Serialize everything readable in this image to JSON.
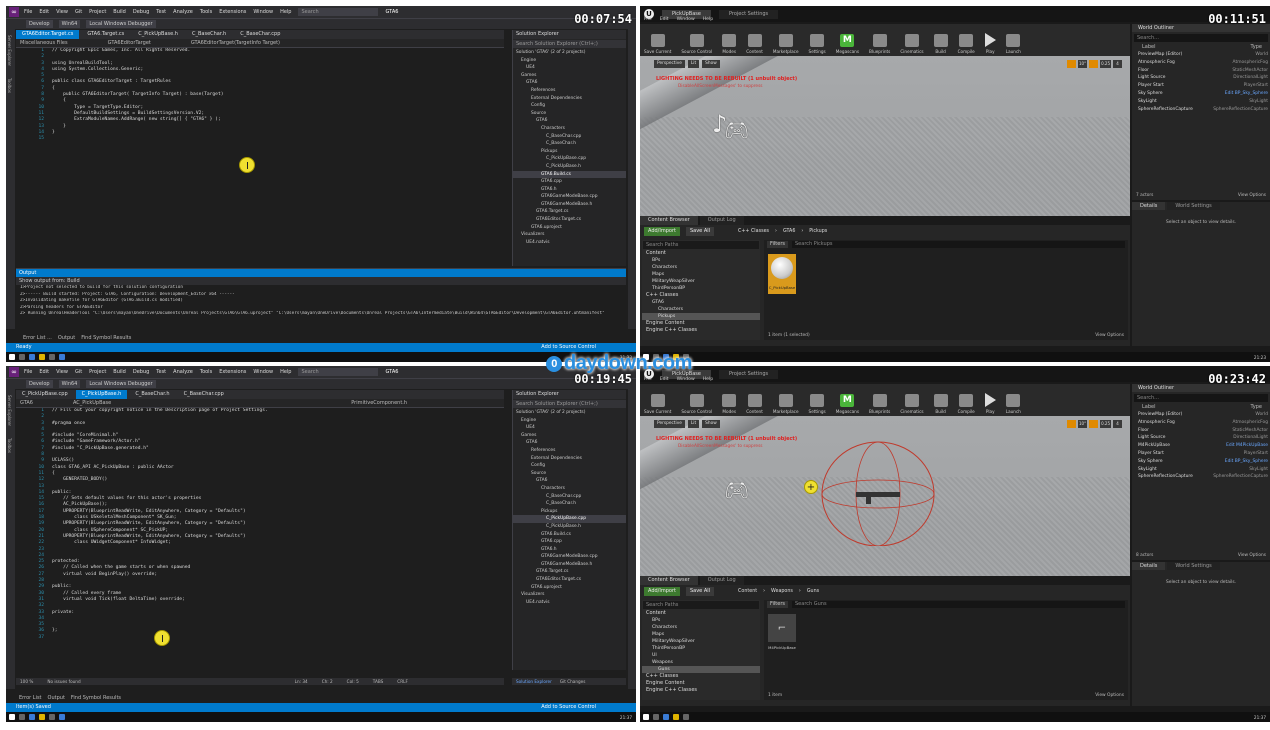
{
  "watermark": "daydown.com",
  "watermark_badge": "0",
  "q1": {
    "timer": "00:07:54",
    "menus": [
      "File",
      "Edit",
      "View",
      "Git",
      "Project",
      "Build",
      "Debug",
      "Test",
      "Analyze",
      "Tools",
      "Extensions",
      "Window",
      "Help"
    ],
    "search": "Search",
    "title": "GTA6",
    "debugger": "Local Windows Debugger",
    "config": "Develop",
    "platform": "Win64",
    "left_strip": [
      "Server Explorer",
      "Toolbox"
    ],
    "tabs": [
      {
        "label": "GTA6Editor.Target.cs",
        "active": true
      },
      {
        "label": "GTA6.Target.cs",
        "active": false
      },
      {
        "label": "C_PickUpBase.h",
        "active": false
      },
      {
        "label": "C_BaseChar.h",
        "active": false
      },
      {
        "label": "C_BaseChar.cpp",
        "active": false
      }
    ],
    "nav": [
      "Miscellaneous Files",
      "GTA6EditorTarget",
      "GTA6EditorTarget(TargetInfo Target)"
    ],
    "code": [
      {
        "n": "1",
        "t": "// Copyright Epic Games, Inc. All Rights Reserved."
      },
      {
        "n": "2",
        "t": ""
      },
      {
        "n": "3",
        "t": "using UnrealBuildTool;"
      },
      {
        "n": "4",
        "t": "using System.Collections.Generic;"
      },
      {
        "n": "5",
        "t": ""
      },
      {
        "n": "6",
        "t": "public class GTA6EditorTarget : TargetRules"
      },
      {
        "n": "7",
        "t": "{"
      },
      {
        "n": "8",
        "t": "    public GTA6EditorTarget( TargetInfo Target) : base(Target)"
      },
      {
        "n": "9",
        "t": "    {"
      },
      {
        "n": "10",
        "t": "        Type = TargetType.Editor;"
      },
      {
        "n": "11",
        "t": "        DefaultBuildSettings = BuildSettingsVersion.V2;"
      },
      {
        "n": "12",
        "t": "        ExtraModuleNames.AddRange( new string[] { \"GTA6\" } );"
      },
      {
        "n": "13",
        "t": "    }"
      },
      {
        "n": "14",
        "t": "}"
      },
      {
        "n": "15",
        "t": ""
      }
    ],
    "se_title": "Solution Explorer",
    "se_search": "Search Solution Explorer (Ctrl+;)",
    "se_items": [
      {
        "t": "Solution 'GTA6' (2 of 2 projects)",
        "d": 0,
        "sel": false
      },
      {
        "t": "Engine",
        "d": 1,
        "sel": false
      },
      {
        "t": "UE4",
        "d": 2,
        "sel": false
      },
      {
        "t": "Games",
        "d": 1,
        "sel": false
      },
      {
        "t": "GTA6",
        "d": 2,
        "sel": false
      },
      {
        "t": "References",
        "d": 3,
        "sel": false
      },
      {
        "t": "External Dependencies",
        "d": 3,
        "sel": false
      },
      {
        "t": "Config",
        "d": 3,
        "sel": false
      },
      {
        "t": "Source",
        "d": 3,
        "sel": false
      },
      {
        "t": "GTA6",
        "d": 4,
        "sel": false
      },
      {
        "t": "Characters",
        "d": 5,
        "sel": false
      },
      {
        "t": "C_BaseChar.cpp",
        "d": 6,
        "sel": false
      },
      {
        "t": "C_BaseChar.h",
        "d": 6,
        "sel": false
      },
      {
        "t": "Pickups",
        "d": 5,
        "sel": false
      },
      {
        "t": "C_PickUpBase.cpp",
        "d": 6,
        "sel": false
      },
      {
        "t": "C_PickUpBase.h",
        "d": 6,
        "sel": false
      },
      {
        "t": "GTA6.Build.cs",
        "d": 5,
        "sel": true
      },
      {
        "t": "GTA6.cpp",
        "d": 5,
        "sel": false
      },
      {
        "t": "GTA6.h",
        "d": 5,
        "sel": false
      },
      {
        "t": "GTA6GameModeBase.cpp",
        "d": 5,
        "sel": false
      },
      {
        "t": "GTA6GameModeBase.h",
        "d": 5,
        "sel": false
      },
      {
        "t": "GTA6.Target.cs",
        "d": 4,
        "sel": false
      },
      {
        "t": "GTA6Editor.Target.cs",
        "d": 4,
        "sel": false
      },
      {
        "t": "GTA6.uproject",
        "d": 3,
        "sel": false
      },
      {
        "t": "Visualizers",
        "d": 1,
        "sel": false
      },
      {
        "t": "UE4.natvis",
        "d": 2,
        "sel": false
      }
    ],
    "output_title": "Output",
    "output_from": "Show output from:  Build",
    "output_lines": [
      "1>Project not selected to build for this solution configuration",
      "2>------ Build started: Project: GTA6, Configuration: Development_Editor x64 ------",
      "2>Invalidating makefile for GTA6Editor (GTA6.Build.cs modified)",
      "2>Parsing headers for GTA6Editor",
      "2>  Running UnrealHeaderTool \"C:\\Users\\mayan\\OneDrive\\Documents\\Unreal Projects\\GTA6\\GTA6.uproject\" \"C:\\Users\\mayan\\OneDrive\\Documents\\Unreal Projects\\GTA6\\Intermediate\\Build\\Win64\\GTA6Editor\\Development\\GTA6Editor.uhtmanifest\""
    ],
    "output_tabs": [
      "Error List ...",
      "Output",
      "Find Symbol Results"
    ],
    "status_left": "Ready",
    "status_right": "Add to Source Control",
    "clock": "21:23"
  },
  "q2": {
    "timer": "00:11:51",
    "tabs": [
      "PickUpBase",
      "Project Settings"
    ],
    "menus": [
      "File",
      "Edit",
      "Window",
      "Help"
    ],
    "tools": [
      "Save Current",
      "Source Control",
      "Modes",
      "Content",
      "Marketplace",
      "Settings",
      "Megascans",
      "Blueprints",
      "Cinematics",
      "Build",
      "Compile",
      "Play",
      "Launch"
    ],
    "vp_buttons": [
      "Perspective",
      "Lit",
      "Show"
    ],
    "vp_right": [
      "10°",
      "0.25",
      "4"
    ],
    "warning": "LIGHTING NEEDS TO BE REBUILT (1 unbuilt object)",
    "warning2": "DisableAllScreenMessages' to suppress",
    "cb_tabs": [
      "Content Browser",
      "Output Log"
    ],
    "add_import": "Add/Import",
    "save_all": "Save All",
    "crumbs": [
      "C++ Classes",
      "GTA6",
      "Pickups"
    ],
    "search_paths": "Search Paths",
    "filters": "Filters",
    "search_assets": "Search Pickups",
    "tree": [
      {
        "t": "Content",
        "d": 0,
        "sel": false
      },
      {
        "t": "BPs",
        "d": 1,
        "sel": false
      },
      {
        "t": "Characters",
        "d": 1,
        "sel": false
      },
      {
        "t": "Maps",
        "d": 1,
        "sel": false
      },
      {
        "t": "MilitaryWeapSilver",
        "d": 1,
        "sel": false
      },
      {
        "t": "ThirdPersonBP",
        "d": 1,
        "sel": false
      },
      {
        "t": "C++ Classes",
        "d": 0,
        "sel": false
      },
      {
        "t": "GTA6",
        "d": 1,
        "sel": false
      },
      {
        "t": "Characters",
        "d": 2,
        "sel": false
      },
      {
        "t": "Pickups",
        "d": 2,
        "sel": true
      },
      {
        "t": "Engine Content",
        "d": 0,
        "sel": false
      },
      {
        "t": "Engine C++ Classes",
        "d": 0,
        "sel": false
      }
    ],
    "asset_label": "C_PickUpBase",
    "count": "1 item (1 selected)",
    "view_options": "View Options",
    "outliner_title": "World Outliner",
    "outliner_search": "Search...",
    "outliner_cols": [
      "Label",
      "Type"
    ],
    "outliner_rows": [
      {
        "l": "PreviewMap (Editor)",
        "t": "World",
        "link": false
      },
      {
        "l": "Atmospheric Fog",
        "t": "AtmosphericFog",
        "link": false
      },
      {
        "l": "Floor",
        "t": "StaticMeshActor",
        "link": false
      },
      {
        "l": "Light Source",
        "t": "DirectionalLight",
        "link": false
      },
      {
        "l": "Player Start",
        "t": "PlayerStart",
        "link": false
      },
      {
        "l": "Sky Sphere",
        "t": "Edit BP_Sky_Sphere",
        "link": true
      },
      {
        "l": "SkyLight",
        "t": "SkyLight",
        "link": false
      },
      {
        "l": "SphereReflectionCapture",
        "t": "SphereReflectionCapture",
        "link": false
      }
    ],
    "actors": "7 actors",
    "details_tabs": [
      "Details",
      "World Settings"
    ],
    "details_msg": "Select an object to view details."
  },
  "q3": {
    "timer": "00:19:45",
    "menus": [
      "File",
      "Edit",
      "View",
      "Git",
      "Project",
      "Build",
      "Debug",
      "Test",
      "Analyze",
      "Tools",
      "Extensions",
      "Window",
      "Help"
    ],
    "search": "Search",
    "title": "GTA6",
    "config": "Develop",
    "platform": "Win64",
    "debugger": "Local Windows Debugger",
    "tabs": [
      {
        "label": "C_PickUpBase.cpp",
        "active": false
      },
      {
        "label": "C_PickUpBase.h",
        "active": true
      },
      {
        "label": "C_BaseChar.h",
        "active": false
      },
      {
        "label": "C_BaseChar.cpp",
        "active": false
      }
    ],
    "nav": [
      "GTA6",
      "AC_PickUpBase",
      "PrimitiveComponent.h"
    ],
    "code": [
      {
        "n": "1",
        "t": "// Fill out your copyright notice in the Description page of Project Settings."
      },
      {
        "n": "2",
        "t": ""
      },
      {
        "n": "3",
        "t": "#pragma once"
      },
      {
        "n": "4",
        "t": ""
      },
      {
        "n": "5",
        "t": "#include \"CoreMinimal.h\""
      },
      {
        "n": "6",
        "t": "#include \"GameFramework/Actor.h\""
      },
      {
        "n": "7",
        "t": "#include \"C_PickUpBase.generated.h\""
      },
      {
        "n": "8",
        "t": ""
      },
      {
        "n": "9",
        "t": "UCLASS()"
      },
      {
        "n": "10",
        "t": "class GTA6_API AC_PickUpBase : public AActor"
      },
      {
        "n": "11",
        "t": "{"
      },
      {
        "n": "12",
        "t": "    GENERATED_BODY()"
      },
      {
        "n": "13",
        "t": ""
      },
      {
        "n": "14",
        "t": "public:"
      },
      {
        "n": "15",
        "t": "    // Sets default values for this actor's properties"
      },
      {
        "n": "16",
        "t": "    AC_PickUpBase();"
      },
      {
        "n": "17",
        "t": "    UPROPERTY(BlueprintReadWrite, EditAnywhere, Category = \"Defaults\")"
      },
      {
        "n": "18",
        "t": "        class USkeletalMeshComponent* SK_Gun;"
      },
      {
        "n": "19",
        "t": "    UPROPERTY(BlueprintReadWrite, EditAnywhere, Category = \"Defaults\")"
      },
      {
        "n": "20",
        "t": "        class USphereComponent* SC_PickUP;"
      },
      {
        "n": "21",
        "t": "    UPROPERTY(BlueprintReadWrite, EditAnywhere, Category = \"Defaults\")"
      },
      {
        "n": "22",
        "t": "        class UWidgetComponent* InfoWidget;"
      },
      {
        "n": "23",
        "t": ""
      },
      {
        "n": "24",
        "t": ""
      },
      {
        "n": "25",
        "t": "protected:"
      },
      {
        "n": "26",
        "t": "    // Called when the game starts or when spawned"
      },
      {
        "n": "27",
        "t": "    virtual void BeginPlay() override;"
      },
      {
        "n": "28",
        "t": ""
      },
      {
        "n": "29",
        "t": "public:"
      },
      {
        "n": "30",
        "t": "    // Called every frame"
      },
      {
        "n": "31",
        "t": "    virtual void Tick(float DeltaTime) override;"
      },
      {
        "n": "32",
        "t": ""
      },
      {
        "n": "33",
        "t": "private:"
      },
      {
        "n": "34",
        "t": ""
      },
      {
        "n": "35",
        "t": ""
      },
      {
        "n": "36",
        "t": "};"
      },
      {
        "n": "37",
        "t": ""
      }
    ],
    "se_title": "Solution Explorer",
    "se_search": "Search Solution Explorer (Ctrl+;)",
    "se_items": [
      {
        "t": "Solution 'GTA6' (2 of 2 projects)",
        "d": 0,
        "sel": false
      },
      {
        "t": "Engine",
        "d": 1,
        "sel": false
      },
      {
        "t": "UE4",
        "d": 2,
        "sel": false
      },
      {
        "t": "Games",
        "d": 1,
        "sel": false
      },
      {
        "t": "GTA6",
        "d": 2,
        "sel": false
      },
      {
        "t": "References",
        "d": 3,
        "sel": false
      },
      {
        "t": "External Dependencies",
        "d": 3,
        "sel": false
      },
      {
        "t": "Config",
        "d": 3,
        "sel": false
      },
      {
        "t": "Source",
        "d": 3,
        "sel": false
      },
      {
        "t": "GTA6",
        "d": 4,
        "sel": false
      },
      {
        "t": "Characters",
        "d": 5,
        "sel": false
      },
      {
        "t": "C_BaseChar.cpp",
        "d": 6,
        "sel": false
      },
      {
        "t": "C_BaseChar.h",
        "d": 6,
        "sel": false
      },
      {
        "t": "Pickups",
        "d": 5,
        "sel": false
      },
      {
        "t": "C_PickUpBase.cpp",
        "d": 6,
        "sel": true
      },
      {
        "t": "C_PickUpBase.h",
        "d": 6,
        "sel": false
      },
      {
        "t": "GTA6.Build.cs",
        "d": 5,
        "sel": false
      },
      {
        "t": "GTA6.cpp",
        "d": 5,
        "sel": false
      },
      {
        "t": "GTA6.h",
        "d": 5,
        "sel": false
      },
      {
        "t": "GTA6GameModeBase.cpp",
        "d": 5,
        "sel": false
      },
      {
        "t": "GTA6GameModeBase.h",
        "d": 5,
        "sel": false
      },
      {
        "t": "GTA6.Target.cs",
        "d": 4,
        "sel": false
      },
      {
        "t": "GTA6Editor.Target.cs",
        "d": 4,
        "sel": false
      },
      {
        "t": "GTA6.uproject",
        "d": 3,
        "sel": false
      },
      {
        "t": "Visualizers",
        "d": 1,
        "sel": false
      },
      {
        "t": "UE4.natvis",
        "d": 2,
        "sel": false
      }
    ],
    "editor_status": [
      "100 %",
      "No issues found",
      "Ln: 34",
      "Ch: 2",
      "Col: 5",
      "TABS",
      "CRLF"
    ],
    "bottom_tabs": [
      "Error List",
      "Output",
      "Find Symbol Results"
    ],
    "se_bottom_tabs": [
      "Solution Explorer",
      "Git Changes"
    ],
    "status_left": "Item(s) Saved",
    "status_right": "Add to Source Control",
    "clock": "21:37"
  },
  "q4": {
    "timer": "00:23:42",
    "tabs": [
      "PickUpBase",
      "Project Settings"
    ],
    "menus": [
      "File",
      "Edit",
      "Window",
      "Help"
    ],
    "tools": [
      "Save Current",
      "Source Control",
      "Modes",
      "Content",
      "Marketplace",
      "Settings",
      "Megascans",
      "Blueprints",
      "Cinematics",
      "Build",
      "Compile",
      "Play",
      "Launch"
    ],
    "vp_buttons": [
      "Perspective",
      "Lit",
      "Show"
    ],
    "vp_right": [
      "10°",
      "0.25",
      "4"
    ],
    "warning": "LIGHTING NEEDS TO BE REBUILT (1 unbuilt object)",
    "warning2": "DisableAllScreenMessages' to suppress",
    "cb_tabs": [
      "Content Browser",
      "Output Log"
    ],
    "add_import": "Add/Import",
    "save_all": "Save All",
    "crumbs": [
      "Content",
      "Weapons",
      "Guns"
    ],
    "search_paths": "Search Paths",
    "filters": "Filters",
    "search_assets": "Search Guns",
    "tree": [
      {
        "t": "Content",
        "d": 0,
        "sel": false
      },
      {
        "t": "BPs",
        "d": 1,
        "sel": false
      },
      {
        "t": "Characters",
        "d": 1,
        "sel": false
      },
      {
        "t": "Maps",
        "d": 1,
        "sel": false
      },
      {
        "t": "MilitaryWeapSilver",
        "d": 1,
        "sel": false
      },
      {
        "t": "ThirdPersonBP",
        "d": 1,
        "sel": false
      },
      {
        "t": "UI",
        "d": 1,
        "sel": false
      },
      {
        "t": "Weapons",
        "d": 1,
        "sel": false
      },
      {
        "t": "Guns",
        "d": 2,
        "sel": true
      },
      {
        "t": "C++ Classes",
        "d": 0,
        "sel": false
      },
      {
        "t": "Engine Content",
        "d": 0,
        "sel": false
      },
      {
        "t": "Engine C++ Classes",
        "d": 0,
        "sel": false
      }
    ],
    "asset_label": "M4PickUpBase",
    "count": "1 item",
    "view_options": "View Options",
    "outliner_title": "World Outliner",
    "outliner_search": "Search...",
    "outliner_cols": [
      "Label",
      "Type"
    ],
    "outliner_rows": [
      {
        "l": "PreviewMap (Editor)",
        "t": "World",
        "link": false
      },
      {
        "l": "Atmospheric Fog",
        "t": "AtmosphericFog",
        "link": false
      },
      {
        "l": "Floor",
        "t": "StaticMeshActor",
        "link": false
      },
      {
        "l": "Light Source",
        "t": "DirectionalLight",
        "link": false
      },
      {
        "l": "M4PickUpBase",
        "t": "Edit M4PickUpBase",
        "link": true
      },
      {
        "l": "Player Start",
        "t": "PlayerStart",
        "link": false
      },
      {
        "l": "Sky Sphere",
        "t": "Edit BP_Sky_Sphere",
        "link": true
      },
      {
        "l": "SkyLight",
        "t": "SkyLight",
        "link": false
      },
      {
        "l": "SphereReflectionCapture",
        "t": "SphereReflectionCapture",
        "link": false
      }
    ],
    "actors": "8 actors",
    "details_tabs": [
      "Details",
      "World Settings"
    ],
    "details_msg": "Select an object to view details."
  }
}
